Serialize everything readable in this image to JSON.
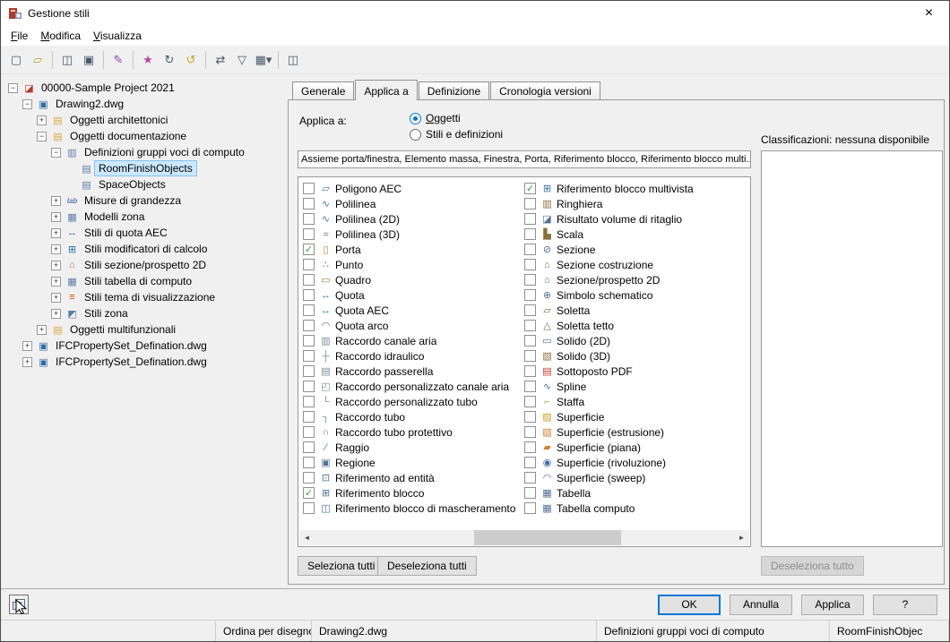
{
  "window": {
    "title": "Gestione stili",
    "close_glyph": "×"
  },
  "menu": {
    "items": [
      {
        "label": "File"
      },
      {
        "label": "Modifica"
      },
      {
        "label": "Visualizza"
      }
    ]
  },
  "toolbar": {
    "groups": [
      [
        {
          "name": "new-drawing-icon",
          "glyph": "▢",
          "color": "#4a5a6a"
        },
        {
          "name": "open-drawing-icon",
          "glyph": "▱",
          "color": "#c9a227"
        }
      ],
      [
        {
          "name": "copy-icon",
          "glyph": "◫",
          "color": "#4a5a6a"
        },
        {
          "name": "paste-icon",
          "glyph": "▣",
          "color": "#4a5a6a"
        }
      ],
      [
        {
          "name": "edit-linework-icon",
          "glyph": "✎",
          "color": "#8e44ad"
        }
      ],
      [
        {
          "name": "toggle-overrides-icon",
          "glyph": "★",
          "color": "#b5489d"
        },
        {
          "name": "synchronize-icon",
          "glyph": "↻",
          "color": "#4a5a6a"
        },
        {
          "name": "update-standards-icon",
          "glyph": "↺",
          "color": "#c9a227"
        }
      ],
      [
        {
          "name": "copy-between-drawings-icon",
          "glyph": "⇄",
          "color": "#4a5a6a"
        },
        {
          "name": "filter-style-icon",
          "glyph": "▽",
          "color": "#4a5a6a"
        },
        {
          "name": "view-menu-icon",
          "glyph": "▦▾",
          "color": "#4a5a6a"
        }
      ],
      [
        {
          "name": "inline-edit-toggle-icon",
          "glyph": "◫",
          "color": "#4a5a6a"
        }
      ]
    ]
  },
  "tree": {
    "items": [
      {
        "label": "00000-Sample Project 2021",
        "level": 0,
        "expander": "minus",
        "icon": "project-icon",
        "glyph": "◪",
        "color": "#b03a2e"
      },
      {
        "label": "Drawing2.dwg",
        "level": 1,
        "expander": "minus",
        "icon": "drawing-icon",
        "glyph": "▣",
        "color": "#2e6da4"
      },
      {
        "label": "Oggetti architettonici",
        "level": 2,
        "expander": "plus",
        "icon": "folder-icon",
        "glyph": "▤",
        "color": "#d8a93e"
      },
      {
        "label": "Oggetti documentazione",
        "level": 2,
        "expander": "minus",
        "icon": "folder-open-icon",
        "glyph": "▤",
        "color": "#d8a93e"
      },
      {
        "label": "Definizioni gruppi voci di computo",
        "level": 3,
        "expander": "minus",
        "icon": "definition-group-icon",
        "glyph": "▥",
        "color": "#5b7fa6"
      },
      {
        "label": "RoomFinishObjects",
        "level": 4,
        "expander": "none",
        "icon": "definition-icon",
        "glyph": "▤",
        "color": "#5b7fa6",
        "selected": true
      },
      {
        "label": "SpaceObjects",
        "level": 4,
        "expander": "none",
        "icon": "definition-icon",
        "glyph": "▤",
        "color": "#5b7fa6"
      },
      {
        "label": "Misure di grandezza",
        "level": 3,
        "expander": "plus",
        "icon": "measure-icon",
        "glyph": "lab",
        "color": "#5b7fa6",
        "small": true
      },
      {
        "label": "Modelli zona",
        "level": 3,
        "expander": "plus",
        "icon": "zone-template-icon",
        "glyph": "▦",
        "color": "#5b7fa6"
      },
      {
        "label": "Stili di quota AEC",
        "level": 3,
        "expander": "plus",
        "icon": "dimension-style-icon",
        "glyph": "↔",
        "color": "#2e6da4"
      },
      {
        "label": "Stili modificatori di calcolo",
        "level": 3,
        "expander": "plus",
        "icon": "calculation-modifier-icon",
        "glyph": "⊞",
        "color": "#2e6da4"
      },
      {
        "label": "Stili sezione/prospetto 2D",
        "level": 3,
        "expander": "plus",
        "icon": "section-elevation-icon",
        "glyph": "⌂",
        "color": "#a8844f"
      },
      {
        "label": "Stili tabella di computo",
        "level": 3,
        "expander": "plus",
        "icon": "schedule-table-icon",
        "glyph": "▦",
        "color": "#5b7fa6"
      },
      {
        "label": "Stili tema di visualizzazione",
        "level": 3,
        "expander": "plus",
        "icon": "display-theme-icon",
        "glyph": "≡",
        "color": "#d35400"
      },
      {
        "label": "Stili zona",
        "level": 3,
        "expander": "plus",
        "icon": "zone-style-icon",
        "glyph": "◩",
        "color": "#5b7fa6"
      },
      {
        "label": "Oggetti multifunzionali",
        "level": 2,
        "expander": "plus",
        "icon": "folder-icon",
        "glyph": "▤",
        "color": "#d8a93e"
      },
      {
        "label": "IFCPropertySet_Defination.dwg",
        "level": 1,
        "expander": "plus",
        "icon": "drawing-icon",
        "glyph": "▣",
        "color": "#2e6da4"
      },
      {
        "label": "IFCPropertySet_Defination.dwg",
        "level": 1,
        "expander": "plus",
        "icon": "drawing-icon",
        "glyph": "▣",
        "color": "#2e6da4"
      }
    ]
  },
  "tabs": [
    {
      "label": "Generale",
      "active": false
    },
    {
      "label": "Applica a",
      "active": true
    },
    {
      "label": "Definizione",
      "active": false
    },
    {
      "label": "Cronologia versioni",
      "active": false
    }
  ],
  "apply_to": {
    "label": "Applica a:",
    "options": [
      {
        "label": "Oggetti",
        "selected": true
      },
      {
        "label": "Stili e definizioni",
        "selected": false
      }
    ],
    "summary": "Assieme porta/finestra, Elemento massa, Finestra, Porta, Riferimento blocco, Riferimento blocco multi...",
    "select_all_label": "Seleziona tutti",
    "deselect_all_label": "Deseleziona tutti",
    "columns": [
      [
        {
          "label": "Poligono AEC",
          "glyph": "▱",
          "color": "#4f7396"
        },
        {
          "label": "Polilinea",
          "glyph": "∿",
          "color": "#4f7396"
        },
        {
          "label": "Polilinea (2D)",
          "glyph": "∿",
          "color": "#4f7396"
        },
        {
          "label": "Polilinea (3D)",
          "glyph": "≈",
          "color": "#4f7396"
        },
        {
          "label": "Porta",
          "checked": true,
          "glyph": "▯",
          "color": "#a9803f"
        },
        {
          "label": "Punto",
          "glyph": "∴",
          "color": "#4f7396"
        },
        {
          "label": "Quadro",
          "glyph": "▭",
          "color": "#a9803f"
        },
        {
          "label": "Quota",
          "glyph": "↔",
          "color": "#4f7396"
        },
        {
          "label": "Quota AEC",
          "glyph": "↔",
          "color": "#2e6da4"
        },
        {
          "label": "Quota arco",
          "glyph": "◠",
          "color": "#4f7396"
        },
        {
          "label": "Raccordo canale aria",
          "glyph": "▥",
          "color": "#7b8a99"
        },
        {
          "label": "Raccordo idraulico",
          "glyph": "┼",
          "color": "#7b8a99"
        },
        {
          "label": "Raccordo passerella",
          "glyph": "▤",
          "color": "#7b8a99"
        },
        {
          "label": "Raccordo personalizzato canale aria",
          "glyph": "◰",
          "color": "#7b8a99"
        },
        {
          "label": "Raccordo personalizzato tubo",
          "glyph": "└",
          "color": "#7b8a99"
        },
        {
          "label": "Raccordo tubo",
          "glyph": "┐",
          "color": "#7b8a99"
        },
        {
          "label": "Raccordo tubo protettivo",
          "glyph": "∩",
          "color": "#7b8a99"
        },
        {
          "label": "Raggio",
          "glyph": "∕",
          "color": "#4f7396"
        },
        {
          "label": "Regione",
          "glyph": "▣",
          "color": "#4f7396"
        },
        {
          "label": "Riferimento ad entità",
          "glyph": "⊡",
          "color": "#4f7396"
        },
        {
          "label": "Riferimento blocco",
          "checked": true,
          "glyph": "⊞",
          "color": "#4f7396"
        },
        {
          "label": "Riferimento blocco di mascheramento",
          "glyph": "◫",
          "color": "#4f7396"
        }
      ],
      [
        {
          "label": "Riferimento blocco multivista",
          "checked": true,
          "glyph": "⊞",
          "color": "#3a6ea5"
        },
        {
          "label": "Ringhiera",
          "glyph": "▥",
          "color": "#8a6d3b"
        },
        {
          "label": "Risultato volume di ritaglio",
          "glyph": "◪",
          "color": "#4f7396"
        },
        {
          "label": "Scala",
          "glyph": "▙",
          "color": "#8a6d3b"
        },
        {
          "label": "Sezione",
          "glyph": "⊘",
          "color": "#4f7396"
        },
        {
          "label": "Sezione costruzione",
          "glyph": "⌂",
          "color": "#8a6d3b"
        },
        {
          "label": "Sezione/prospetto 2D",
          "glyph": "⌂",
          "color": "#4f7396"
        },
        {
          "label": "Simbolo schematico",
          "glyph": "⊕",
          "color": "#4f7396"
        },
        {
          "label": "Soletta",
          "glyph": "▱",
          "color": "#8a6d3b"
        },
        {
          "label": "Soletta tetto",
          "glyph": "△",
          "color": "#8a6d3b"
        },
        {
          "label": "Solido (2D)",
          "glyph": "▭",
          "color": "#4f7396"
        },
        {
          "label": "Solido (3D)",
          "glyph": "▧",
          "color": "#8a6d3b"
        },
        {
          "label": "Sottoposto PDF",
          "glyph": "▤",
          "color": "#c0392b"
        },
        {
          "label": "Spline",
          "glyph": "∿",
          "color": "#4f7396"
        },
        {
          "label": "Staffa",
          "glyph": "⌐",
          "color": "#c9a227"
        },
        {
          "label": "Superficie",
          "glyph": "▨",
          "color": "#c9a227"
        },
        {
          "label": "Superficie (estrusione)",
          "glyph": "▧",
          "color": "#d07f2e"
        },
        {
          "label": "Superficie (piana)",
          "glyph": "▰",
          "color": "#d07f2e"
        },
        {
          "label": "Superficie (rivoluzione)",
          "glyph": "◉",
          "color": "#3a6ea5"
        },
        {
          "label": "Superficie (sweep)",
          "glyph": "◠",
          "color": "#3a6ea5"
        },
        {
          "label": "Tabella",
          "glyph": "▦",
          "color": "#4f7396"
        },
        {
          "label": "Tabella computo",
          "glyph": "▦",
          "color": "#4f7396"
        }
      ]
    ]
  },
  "classifications": {
    "label": "Classificazioni: nessuna disponibile",
    "items": [],
    "deselect_label": "Deseleziona tutto"
  },
  "footer": {
    "ok": "OK",
    "cancel": "Annulla",
    "apply": "Applica",
    "help": "?"
  },
  "statusbar": {
    "sections": [
      "",
      "Ordina per disegno",
      "Drawing2.dwg",
      "Definizioni gruppi voci di computo",
      "RoomFinishObjec"
    ]
  },
  "colors": {
    "accent": "#0078d7",
    "check": "#2f9e2f",
    "selection_bg": "#cce8ff",
    "selection_border": "#84c3f1"
  }
}
